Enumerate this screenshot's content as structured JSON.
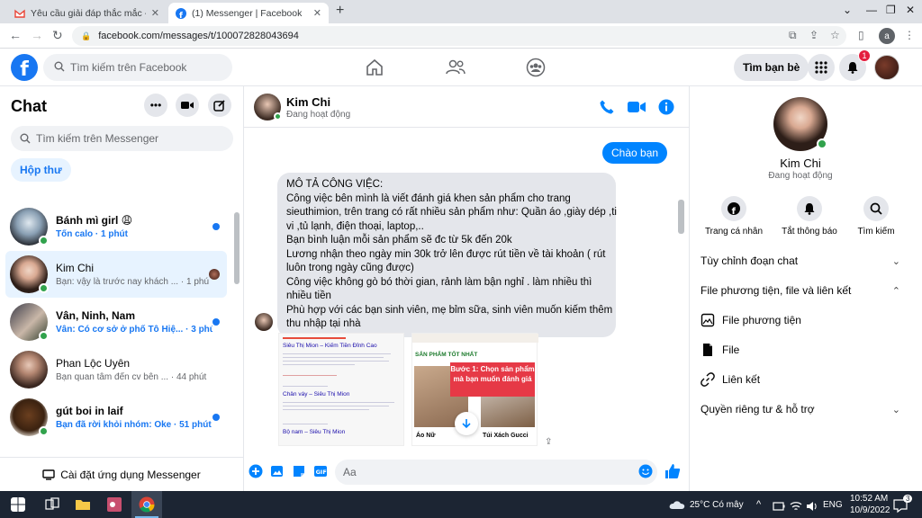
{
  "browser": {
    "tabs": [
      {
        "title": "Yêu cầu giải đáp thắc mắc - anhtu",
        "active": false
      },
      {
        "title": "(1) Messenger | Facebook",
        "active": true
      }
    ],
    "url": "facebook.com/messages/t/100072828043694",
    "profile_initial": "a"
  },
  "facebook": {
    "search_placeholder": "Tìm kiếm trên Facebook",
    "find_friends": "Tìm bạn bè",
    "notif_count": "1"
  },
  "chat_list": {
    "title": "Chat",
    "search_placeholder": "Tìm kiếm trên Messenger",
    "inbox_label": "Hộp thư",
    "conversations": [
      {
        "name": "Bánh mì girl 😩",
        "preview": "Tốn calo · 1 phút",
        "unread": true,
        "bold": true
      },
      {
        "name": "Kim Chi",
        "preview": "Bạn: vậy là trước nay khách ... · 1 phút",
        "unread": false,
        "bold": false
      },
      {
        "name": "Vân, Ninh, Nam",
        "preview": "Vân: Có cơ sở ở phố Tô Hiệ... · 3 phút",
        "unread": true,
        "bold": true
      },
      {
        "name": "Phan Lộc Uyên",
        "preview": "Bạn quan tâm đến cv bên ... · 44 phút",
        "unread": false,
        "bold": false
      },
      {
        "name": "gút boi in laif",
        "preview": "Bạn đã rời khỏi nhóm: Oke · 51 phút",
        "unread": true,
        "bold": true
      }
    ],
    "install_app": "Cài đặt ứng dụng Messenger"
  },
  "conversation": {
    "name": "Kim Chi",
    "status": "Đang hoạt động",
    "my_message": "Chào bạn",
    "their_message_lines": [
      "MÔ TẢ CÔNG VIỆC:",
      "Công việc bên mình là viết đánh giá khen sản phẩm cho trang",
      "sieuthimion, trên trang có rất nhiều sản phẩm như: Quần áo ,giày dép ,ti",
      "vi ,tủ lạnh, điện thoại, laptop,..",
      "Bạn bình luận mỗi sản phẩm sẽ đc từ 5k đến 20k",
      "Lương nhận theo ngày min 30k trở lên được rút tiền về tài khoản ( rút",
      "luôn trong ngày cũng được)",
      "Công việc không gò bó thời gian, rảnh làm bận nghỉ . làm nhiều thì",
      "nhiều tiền",
      "Phù hợp với các bạn sinh viên, mẹ bỉm sữa, sinh viên muốn kiếm thêm",
      "thu nhập tại nhà"
    ],
    "image1": {
      "title": "Siêu Thị Mion – Kiếm Tiền Đỉnh Cao",
      "link2": "Chân váy – Siêu Thị Mion",
      "link3": "Bộ nam – Siêu Thị Mion"
    },
    "image2": {
      "header": "SẢN PHẨM TỐT NHẤT",
      "step": "Bước 1: Chọn sản phẩm mà bạn muốn đánh giá",
      "product1": "Áo Nữ",
      "product2": "Túi Xách Gucci"
    },
    "composer_placeholder": "Aa"
  },
  "info_panel": {
    "name": "Kim Chi",
    "status": "Đang hoạt động",
    "actions": [
      "Trang cá nhân",
      "Tắt thông báo",
      "Tìm kiếm"
    ],
    "sections": {
      "customize": "Tùy chỉnh đoạn chat",
      "media": "File phương tiện, file và liên kết",
      "media_items": [
        "File phương tiện",
        "File",
        "Liên kết"
      ],
      "privacy": "Quyền riêng tư & hỗ trợ"
    }
  },
  "taskbar": {
    "weather": "25°C  Có mây",
    "lang": "ENG",
    "time": "10:52 AM",
    "date": "10/9/2022",
    "notif": "3"
  },
  "colors": {
    "fb_blue": "#1877f2",
    "messenger_blue": "#0084ff",
    "online": "#31a24c",
    "badge": "#e41e3f"
  }
}
